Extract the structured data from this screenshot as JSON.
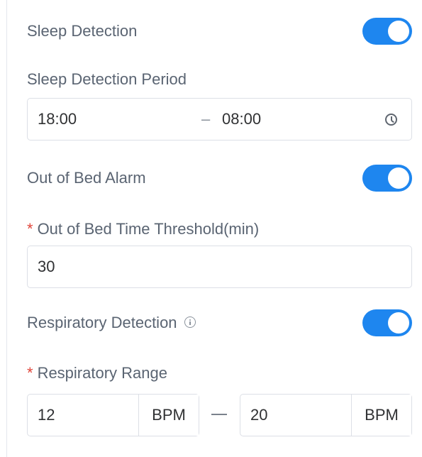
{
  "sleep_detection": {
    "label": "Sleep Detection",
    "enabled": true
  },
  "sleep_period": {
    "label": "Sleep Detection Period",
    "start": "18:00",
    "separator": "–",
    "end": "08:00",
    "icon": "clock-icon"
  },
  "out_of_bed_alarm": {
    "label": "Out of Bed Alarm",
    "enabled": true
  },
  "out_of_bed_threshold": {
    "required_mark": "*",
    "label": "Out of Bed Time Threshold(min)",
    "value": "30"
  },
  "respiratory_detection": {
    "label": "Respiratory Detection",
    "info_icon": "info-icon",
    "enabled": true
  },
  "respiratory_range": {
    "required_mark": "*",
    "label": "Respiratory Range",
    "min": "12",
    "min_unit": "BPM",
    "max": "20",
    "max_unit": "BPM"
  },
  "colors": {
    "toggle_on": "#1e86ef",
    "required": "#e0453a",
    "border": "#dcdfe6"
  }
}
